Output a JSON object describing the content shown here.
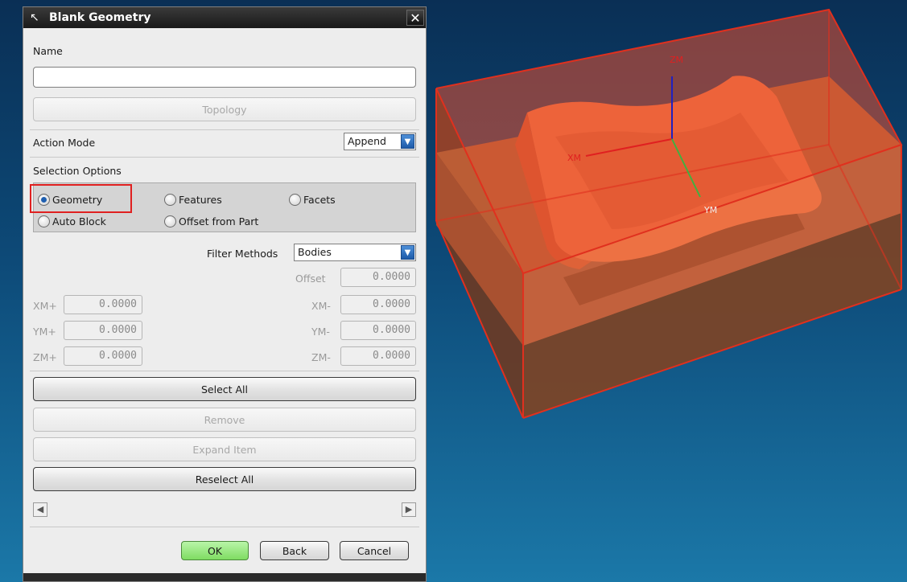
{
  "dialog": {
    "title": "Blank Geometry",
    "name_label": "Name",
    "name_value": "",
    "topology_button": "Topology",
    "action_mode_label": "Action Mode",
    "action_mode_value": "Append",
    "selection_options_label": "Selection Options",
    "radios": {
      "geometry": "Geometry",
      "features": "Features",
      "facets": "Facets",
      "auto_block": "Auto Block",
      "offset_from_part": "Offset from Part"
    },
    "selected_radio": "Geometry",
    "filter_methods_label": "Filter Methods",
    "filter_methods_value": "Bodies",
    "offset_label": "Offset",
    "offset_value": "0.0000",
    "limits": {
      "xm_plus_label": "XM+",
      "xm_plus": "0.0000",
      "ym_plus_label": "YM+",
      "ym_plus": "0.0000",
      "zm_plus_label": "ZM+",
      "zm_plus": "0.0000",
      "xm_minus_label": "XM-",
      "xm_minus": "0.0000",
      "ym_minus_label": "YM-",
      "ym_minus": "0.0000",
      "zm_minus_label": "ZM-",
      "zm_minus": "0.0000"
    },
    "buttons": {
      "select_all": "Select All",
      "remove": "Remove",
      "expand_item": "Expand Item",
      "reselect_all": "Reselect All",
      "ok": "OK",
      "back": "Back",
      "cancel": "Cancel"
    }
  },
  "viewport": {
    "axis_labels": {
      "zm": "ZM",
      "xm": "XM",
      "ym": "YM"
    },
    "colors": {
      "blank_box": "#e0301e",
      "part": "#f07040",
      "background_top": "#0a2f55",
      "background_bottom": "#1b78a8"
    }
  }
}
